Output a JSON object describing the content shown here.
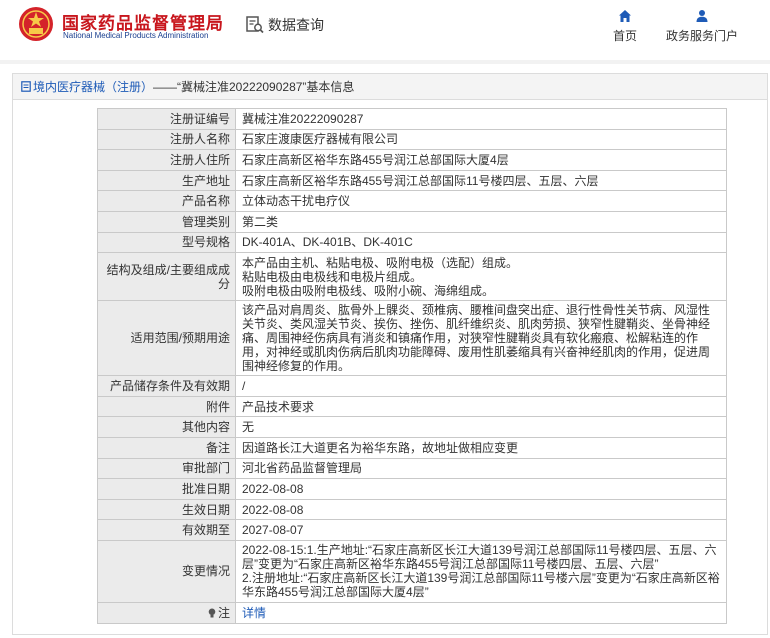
{
  "header": {
    "site_title_cn": "国家药品监督管理局",
    "site_title_en": "National Medical Products Administration",
    "query_label": "数据查询",
    "nav_home": "首页",
    "nav_services": "政务服务门户"
  },
  "breadcrumb": {
    "category_link": "境内医疗器械（注册）",
    "separator": " —— ",
    "record_title": "“冀械注准20222090287”基本信息"
  },
  "rows": [
    {
      "label": "注册证编号",
      "value": "冀械注准20222090287"
    },
    {
      "label": "注册人名称",
      "value": "石家庄渡康医疗器械有限公司"
    },
    {
      "label": "注册人住所",
      "value": "石家庄高新区裕华东路455号润江总部国际大厦4层"
    },
    {
      "label": "生产地址",
      "value": "石家庄高新区裕华东路455号润江总部国际11号楼四层、五层、六层"
    },
    {
      "label": "产品名称",
      "value": "立体动态干扰电疗仪"
    },
    {
      "label": "管理类别",
      "value": "第二类"
    },
    {
      "label": "型号规格",
      "value": "DK-401A、DK-401B、DK-401C"
    },
    {
      "label": "结构及组成/主要组成成分",
      "value": "本产品由主机、粘贴电极、吸附电极（选配）组成。\n粘贴电极由电极线和电极片组成。\n吸附电极由吸附电极线、吸附小碗、海绵组成。"
    },
    {
      "label": "适用范围/预期用途",
      "value": "该产品对肩周炎、肱骨外上髁炎、颈椎病、腰椎间盘突出症、退行性骨性关节病、风湿性关节炎、类风湿关节炎、挨伤、挫伤、肌纤维织炎、肌肉劳损、狭窄性腱鞘炎、坐骨神经痛、周围神经伤病具有消炎和镇痛作用，对狭窄性腱鞘炎具有软化瘢痕、松解粘连的作用，对神经或肌肉伤病后肌肉功能障碍、废用性肌萎缩具有兴奋神经肌肉的作用，促进周围神经修复的作用。"
    },
    {
      "label": "产品储存条件及有效期",
      "value": "/"
    },
    {
      "label": "附件",
      "value": "产品技术要求"
    },
    {
      "label": "其他内容",
      "value": "无"
    },
    {
      "label": "备注",
      "value": "因道路长江大道更名为裕华东路，故地址做相应变更"
    },
    {
      "label": "审批部门",
      "value": "河北省药品监督管理局"
    },
    {
      "label": "批准日期",
      "value": "2022-08-08"
    },
    {
      "label": "生效日期",
      "value": "2022-08-08"
    },
    {
      "label": "有效期至",
      "value": "2027-08-07"
    },
    {
      "label": "变更情况",
      "value": "2022-08-15:1.生产地址:“石家庄高新区长江大道139号润江总部国际11号楼四层、五层、六层”变更为“石家庄高新区裕华东路455号润江总部国际11号楼四层、五层、六层”\n2.注册地址:“石家庄高新区长江大道139号润江总部国际11号楼六层”变更为“石家庄高新区裕华东路455号润江总部国际大厦4层”"
    }
  ],
  "note": {
    "label": "注",
    "link_text": "详情"
  },
  "colors": {
    "brand_red": "#c8161d",
    "link_blue": "#1e5bb7",
    "label_bg": "#ebebeb"
  }
}
